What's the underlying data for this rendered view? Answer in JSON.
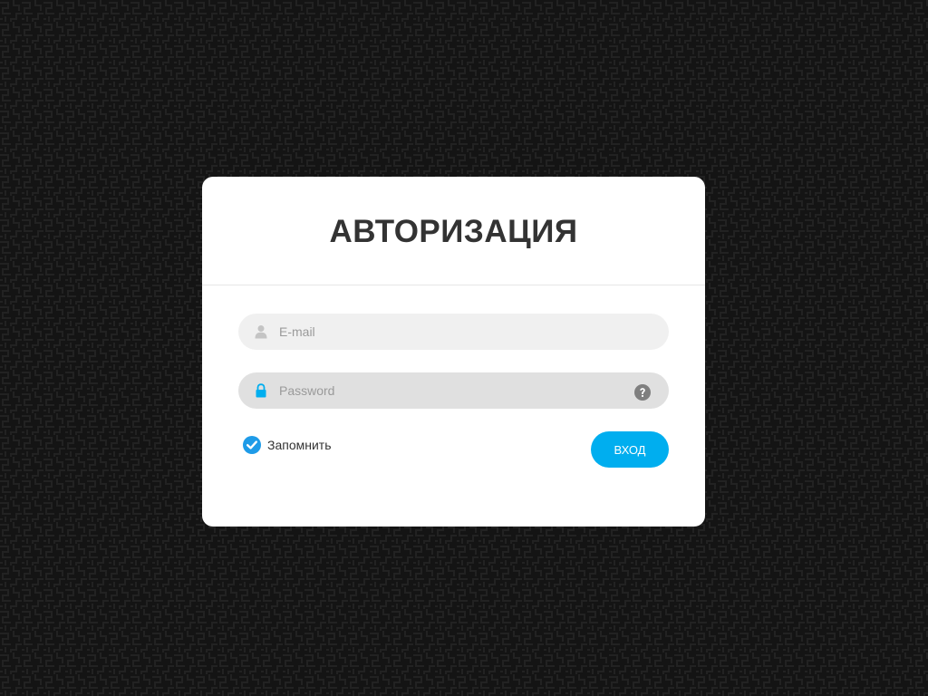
{
  "login": {
    "title": "АВТОРИЗАЦИЯ",
    "email": {
      "icon": "user-icon",
      "placeholder": "E-mail",
      "value": ""
    },
    "password": {
      "icon": "lock-icon",
      "placeholder": "Password",
      "value": "",
      "help_icon": "question-circle-icon"
    },
    "remember": {
      "label": "Запомнить",
      "checked": true
    },
    "submit_label": "ВХОД"
  },
  "colors": {
    "accent": "#00aeef",
    "checkbox": "#1e9be8",
    "card": "#ffffff",
    "title": "#333333",
    "background": "#151515"
  }
}
